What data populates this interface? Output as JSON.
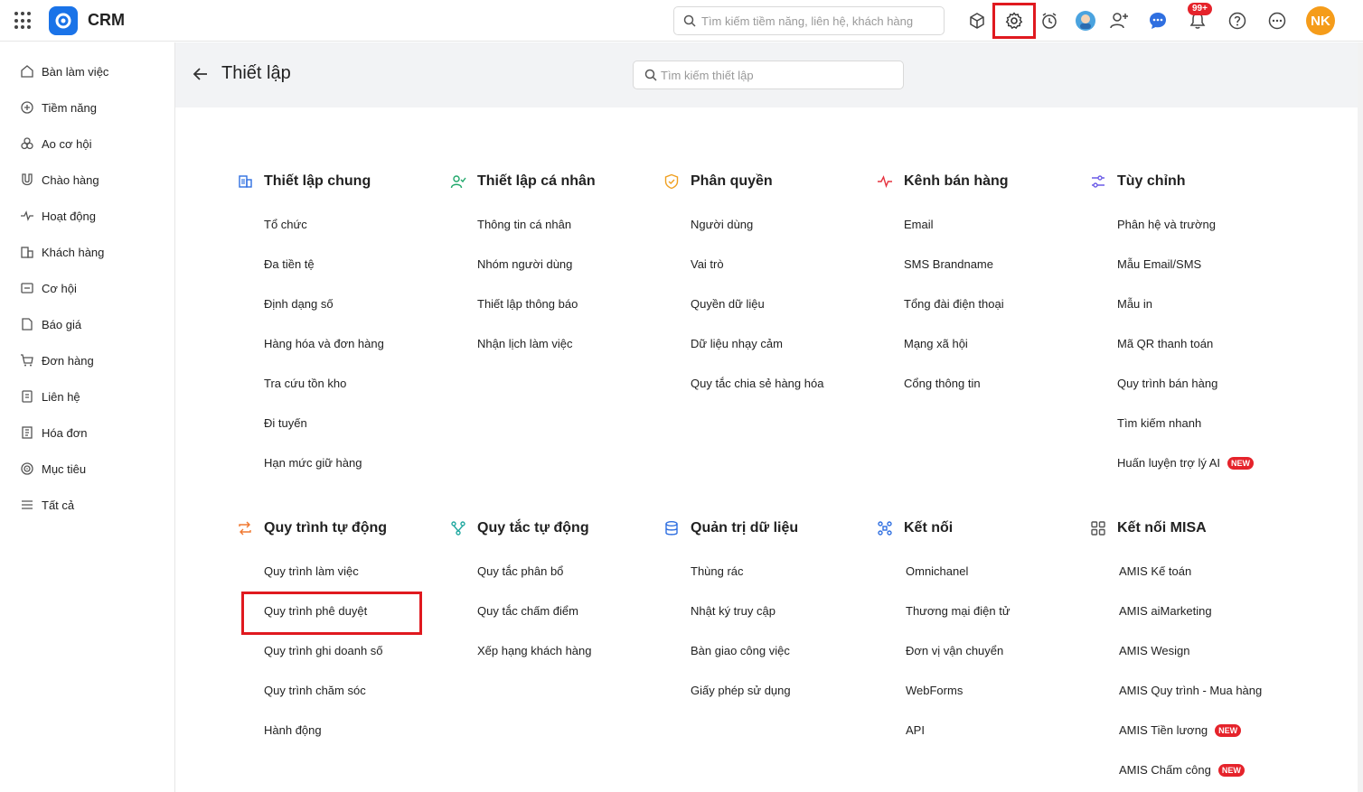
{
  "app": {
    "name": "CRM",
    "notification_count": "99+",
    "user_initials": "NK"
  },
  "global_search": {
    "placeholder": "Tìm kiếm tiềm năng, liên hệ, khách hàng"
  },
  "sidebar": {
    "items": [
      {
        "label": "Bàn làm việc",
        "icon": "home-icon"
      },
      {
        "label": "Tiềm năng",
        "icon": "target-circle-icon"
      },
      {
        "label": "Ao cơ hội",
        "icon": "circles-icon"
      },
      {
        "label": "Chào hàng",
        "icon": "magnet-icon"
      },
      {
        "label": "Hoạt động",
        "icon": "pulse-icon"
      },
      {
        "label": "Khách hàng",
        "icon": "building-icon"
      },
      {
        "label": "Cơ hội",
        "icon": "folder-icon"
      },
      {
        "label": "Báo giá",
        "icon": "document-icon"
      },
      {
        "label": "Đơn hàng",
        "icon": "cart-icon"
      },
      {
        "label": "Liên hệ",
        "icon": "contact-card-icon"
      },
      {
        "label": "Hóa đơn",
        "icon": "invoice-icon"
      },
      {
        "label": "Mục tiêu",
        "icon": "goal-icon"
      },
      {
        "label": "Tất cả",
        "icon": "menu-icon"
      }
    ]
  },
  "settings": {
    "title": "Thiết lập",
    "search_placeholder": "Tìm kiếm thiết lập",
    "sections": [
      {
        "title": "Thiết lập chung",
        "icon": "building-icon",
        "items": [
          "Tổ chức",
          "Đa tiền tệ",
          "Định dạng số",
          "Hàng hóa và đơn hàng",
          "Tra cứu tồn kho",
          "Đi tuyến",
          "Hạn mức giữ hàng"
        ]
      },
      {
        "title": "Thiết lập cá nhân",
        "icon": "user-check-icon",
        "items": [
          "Thông tin cá nhân",
          "Nhóm người dùng",
          "Thiết lập thông báo",
          "Nhận lịch làm việc"
        ]
      },
      {
        "title": "Phân quyền",
        "icon": "shield-icon",
        "items": [
          "Người dùng",
          "Vai trò",
          "Quyền dữ liệu",
          "Dữ liệu nhạy cảm",
          "Quy tắc chia sẻ hàng hóa"
        ]
      },
      {
        "title": "Kênh bán hàng",
        "icon": "pulse-icon",
        "items": [
          "Email",
          "SMS Brandname",
          "Tổng đài điện thoại",
          "Mạng xã hội",
          "Cổng thông tin"
        ]
      },
      {
        "title": "Tùy chỉnh",
        "icon": "sliders-icon",
        "items": [
          "Phân hệ và trường",
          "Mẫu Email/SMS",
          "Mẫu in",
          "Mã QR thanh toán",
          "Quy trình bán hàng",
          "Tìm kiếm nhanh",
          "Huấn luyện trợ lý AI"
        ]
      },
      {
        "title": "Quy trình tự động",
        "icon": "repeat-icon",
        "items": [
          "Quy trình làm việc",
          "Quy trình phê duyệt",
          "Quy trình ghi doanh số",
          "Quy trình chăm sóc",
          "Hành động"
        ]
      },
      {
        "title": "Quy tắc tự động",
        "icon": "branch-icon",
        "items": [
          "Quy tắc phân bổ",
          "Quy tắc chấm điểm",
          "Xếp hạng khách hàng"
        ]
      },
      {
        "title": "Quản trị dữ liệu",
        "icon": "database-icon",
        "items": [
          "Thùng rác",
          "Nhật ký truy cập",
          "Bàn giao công việc",
          "Giấy phép sử dụng"
        ]
      },
      {
        "title": "Kết nối",
        "icon": "connect-icon",
        "items": [
          "Omnichanel",
          "Thương mại điện tử",
          "Đơn vị vận chuyển",
          "WebForms",
          "API"
        ]
      },
      {
        "title": "Kết nối MISA",
        "icon": "grid-icon",
        "items": [
          "AMIS Kế toán",
          "AMIS aiMarketing",
          "AMIS Wesign",
          "AMIS Quy trình - Mua hàng",
          "AMIS Tiền lương",
          "AMIS Chấm công"
        ]
      }
    ],
    "new_label": "NEW"
  },
  "colors": {
    "accent_red": "#e0191f",
    "brand_blue": "#1a73e8",
    "avatar_orange": "#f59c1a"
  }
}
